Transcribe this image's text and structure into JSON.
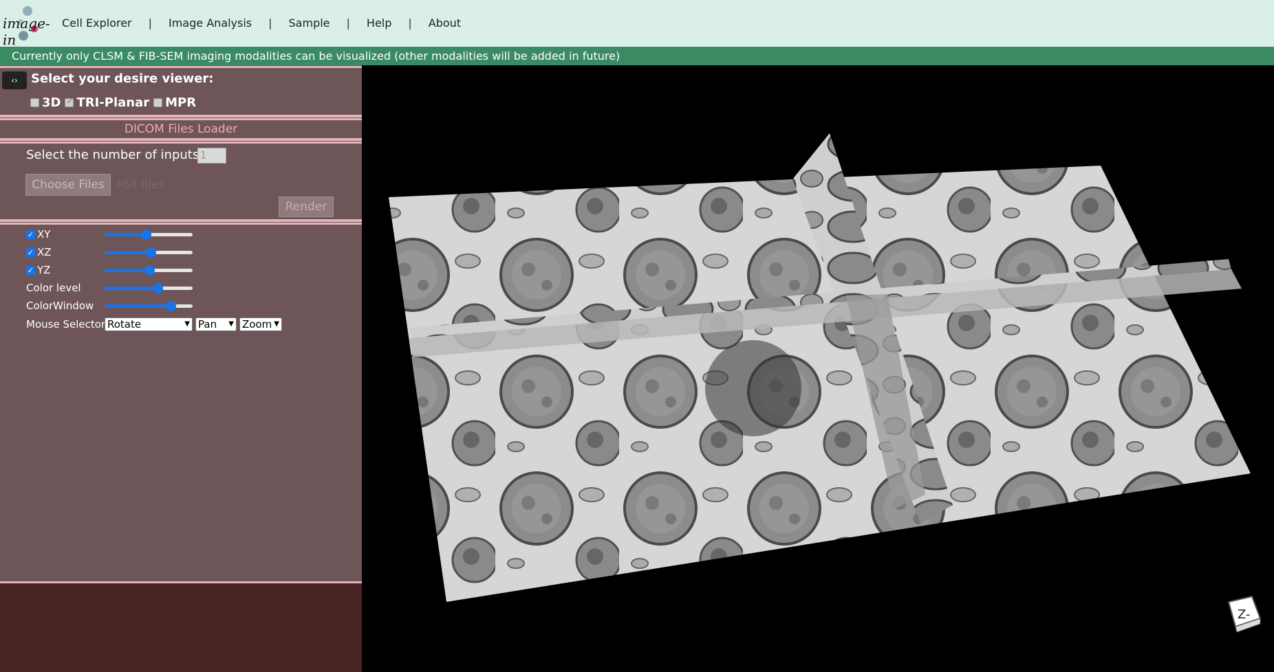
{
  "header": {
    "logo_text": "image-in",
    "nav": [
      "Cell Explorer",
      "Image Analysis",
      "Sample",
      "Help",
      "About"
    ],
    "separator": "|"
  },
  "notice": "Currently only CLSM & FIB-SEM imaging modalities can be visualized (other modalities will be added in future)",
  "sidebar": {
    "toggle_icon": "‹›",
    "viewer_title": "Select your desire viewer:",
    "viewer_options": [
      {
        "label": "3D",
        "checked": false
      },
      {
        "label": "TRI-Planar",
        "checked": true
      },
      {
        "label": "MPR",
        "checked": false
      }
    ],
    "loader_title": "DICOM Files Loader",
    "inputs_label": "Select the number of inputs:",
    "inputs_value": "1",
    "choose_files": "Choose Files",
    "files_count": "464 files",
    "render": "Render",
    "controls": [
      {
        "label": "XY",
        "checkbox": true,
        "value": 0.47
      },
      {
        "label": "XZ",
        "checkbox": true,
        "value": 0.53
      },
      {
        "label": "YZ",
        "checkbox": true,
        "value": 0.51
      },
      {
        "label": "Color level",
        "checkbox": false,
        "value": 0.62
      },
      {
        "label": "ColorWindow",
        "checkbox": false,
        "value": 0.79
      }
    ],
    "mouse_selector_label": "Mouse Selector",
    "mouse_selects": [
      "Rotate",
      "Pan",
      "Zoom"
    ]
  },
  "viewport": {
    "orientation_label": "Z-"
  },
  "colors": {
    "topbar": "#d9efe8",
    "notice": "#3a8a63",
    "sidebar": "#6d5558",
    "sidebar_bottom": "#482424",
    "accent": "#1a73e8",
    "loader_title": "#f4a6b8"
  }
}
